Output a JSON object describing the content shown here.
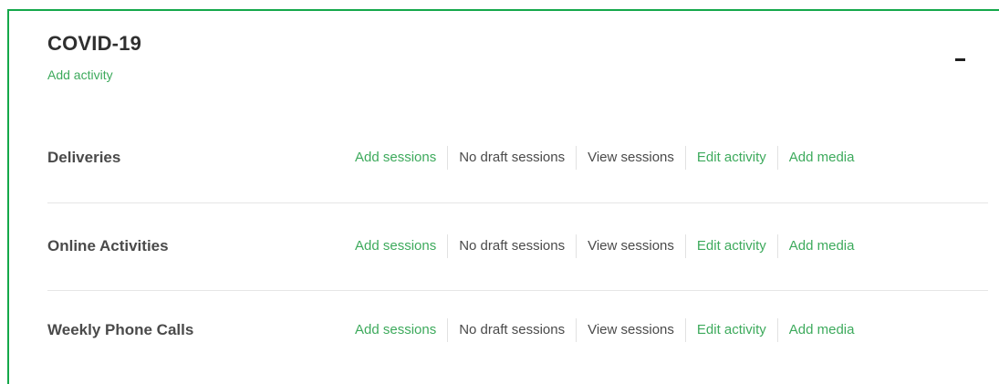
{
  "group": {
    "title": "COVID-19",
    "add_activity_label": "Add activity",
    "collapse_icon": "minus-icon"
  },
  "activities": [
    {
      "name": "Deliveries",
      "actions": {
        "add_sessions": "Add sessions",
        "draft_sessions": "No draft sessions",
        "view_sessions": "View sessions",
        "edit_activity": "Edit activity",
        "add_media": "Add media"
      }
    },
    {
      "name": "Online Activities",
      "actions": {
        "add_sessions": "Add sessions",
        "draft_sessions": "No draft sessions",
        "view_sessions": "View sessions",
        "edit_activity": "Edit activity",
        "add_media": "Add media"
      }
    },
    {
      "name": "Weekly Phone Calls",
      "actions": {
        "add_sessions": "Add sessions",
        "draft_sessions": "No draft sessions",
        "view_sessions": "View sessions",
        "edit_activity": "Edit activity",
        "add_media": "Add media"
      }
    }
  ],
  "colors": {
    "accent_green": "#14a84a",
    "link_green": "#3daa5c",
    "text_dark": "#2f2f2f",
    "text_gray": "#4a4a4a"
  }
}
